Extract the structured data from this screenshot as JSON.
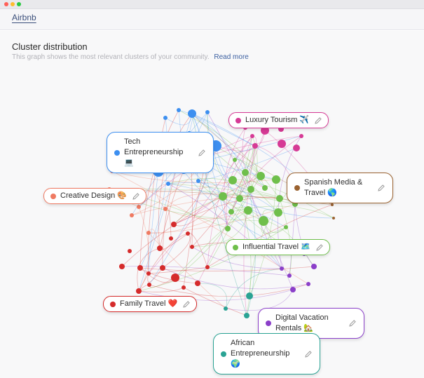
{
  "window": {
    "tab_label": "Airbnb"
  },
  "header": {
    "title": "Cluster distribution",
    "subtitle": "This graph shows the most relevant clusters of your community.",
    "read_more": "Read more"
  },
  "colors": {
    "tech": "#3d8ff0",
    "luxury": "#d63a95",
    "spanish": "#9a6230",
    "creative": "#ef7a62",
    "influential": "#6fbf4b",
    "family": "#d52b2b",
    "digital": "#8b3fc9",
    "african": "#2aa394"
  },
  "clusters": [
    {
      "id": "tech",
      "label": "Tech Entrepreneurship 💻",
      "color": "#3d8ff0",
      "icon": "pencil-icon"
    },
    {
      "id": "luxury",
      "label": "Luxury Tourism ✈️",
      "color": "#d63a95",
      "icon": "pencil-icon"
    },
    {
      "id": "spanish",
      "label": "Spanish Media & Travel 🌎",
      "color": "#9a6230",
      "icon": "pencil-icon"
    },
    {
      "id": "creative",
      "label": "Creative Design 🎨",
      "color": "#ef7a62",
      "icon": "pencil-icon"
    },
    {
      "id": "influential",
      "label": "Influential Travel 🗺️",
      "color": "#6fbf4b",
      "icon": "pencil-icon"
    },
    {
      "id": "family",
      "label": "Family Travel ❤️",
      "color": "#d52b2b",
      "icon": "pencil-icon"
    },
    {
      "id": "digital",
      "label": "Digital Vacation Rentals 🏡",
      "color": "#8b3fc9",
      "icon": "pencil-icon"
    },
    {
      "id": "african",
      "label": "African Entrepreneurship 🌍",
      "color": "#2aa394",
      "icon": "pencil-icon"
    }
  ]
}
